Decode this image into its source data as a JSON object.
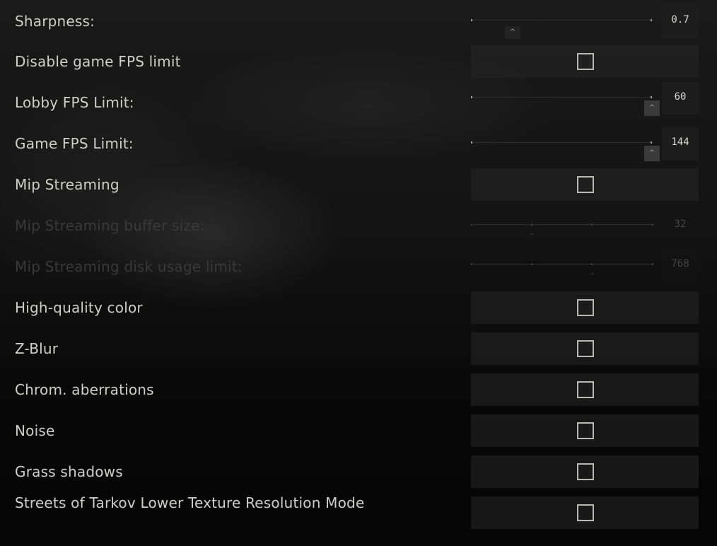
{
  "settings": {
    "sharpness": {
      "label": "Sharpness:",
      "value": "0.7",
      "level": 0.22
    },
    "disable_fps_limit": {
      "label": "Disable game FPS limit",
      "checked": false
    },
    "lobby_fps": {
      "label": "Lobby FPS Limit:",
      "value": "60",
      "level": 1.0
    },
    "game_fps": {
      "label": "Game FPS Limit:",
      "value": "144",
      "level": 1.0
    },
    "mip_streaming": {
      "label": "Mip Streaming",
      "checked": false
    },
    "mip_buffer": {
      "label": "Mip Streaming buffer size:",
      "value": "32",
      "level": 0.33,
      "enabled": false
    },
    "mip_disk": {
      "label": "Mip Streaming disk usage limit:",
      "value": "768",
      "level": 0.67,
      "enabled": false
    },
    "hq_color": {
      "label": "High-quality color",
      "checked": false
    },
    "z_blur": {
      "label": "Z-Blur",
      "checked": false
    },
    "chrom_aberr": {
      "label": "Chrom. aberrations",
      "checked": false
    },
    "noise": {
      "label": "Noise",
      "checked": false
    },
    "grass_shadows": {
      "label": "Grass shadows",
      "checked": false
    },
    "streets_lower_tex": {
      "label": "Streets of Tarkov Lower Texture Resolution Mode",
      "checked": false
    }
  },
  "icons": {
    "slider_handle_glyph": "^"
  }
}
